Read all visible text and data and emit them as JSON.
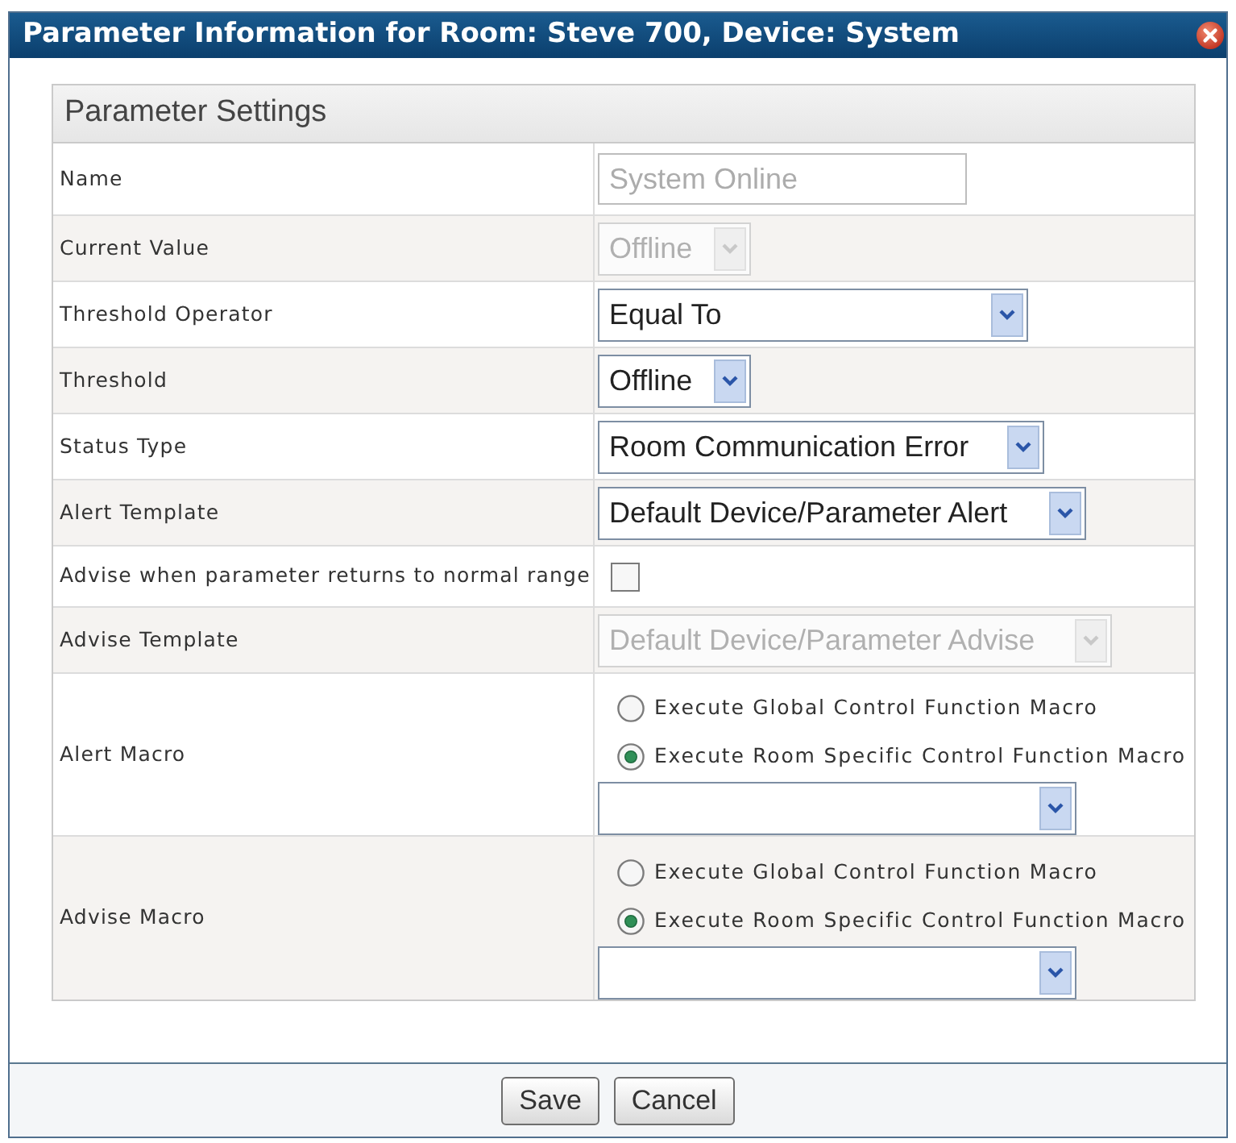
{
  "window": {
    "title": "Parameter Information for Room: Steve 700, Device: System"
  },
  "panel": {
    "title": "Parameter Settings",
    "rows": [
      {
        "label": "Name",
        "kind": "text",
        "value": "System Online",
        "disabled": true
      },
      {
        "label": "Current Value",
        "kind": "select",
        "value": "Offline",
        "disabled": true
      },
      {
        "label": "Threshold Operator",
        "kind": "select",
        "value": "Equal To",
        "disabled": false
      },
      {
        "label": "Threshold",
        "kind": "select",
        "value": "Offline",
        "disabled": false
      },
      {
        "label": "Status Type",
        "kind": "select",
        "value": "Room Communication Error",
        "disabled": false
      },
      {
        "label": "Alert Template",
        "kind": "select",
        "value": "Default Device/Parameter Alert",
        "disabled": false
      },
      {
        "label": "Advise when parameter returns to normal range",
        "kind": "checkbox",
        "checked": false
      },
      {
        "label": "Advise Template",
        "kind": "select",
        "value": "Default Device/Parameter Advise",
        "disabled": true
      },
      {
        "label": "Alert Macro",
        "kind": "macro",
        "options": [
          {
            "label": "Execute Global Control Function Macro",
            "selected": false
          },
          {
            "label": "Execute Room Specific Control Function Macro",
            "selected": true
          }
        ]
      },
      {
        "label": "Advise Macro",
        "kind": "macro",
        "options": [
          {
            "label": "Execute Global Control Function Macro",
            "selected": false
          },
          {
            "label": "Execute Room Specific Control Function Macro",
            "selected": true
          }
        ]
      }
    ]
  },
  "buttons": [
    {
      "label": "Save"
    },
    {
      "label": "Cancel"
    }
  ]
}
